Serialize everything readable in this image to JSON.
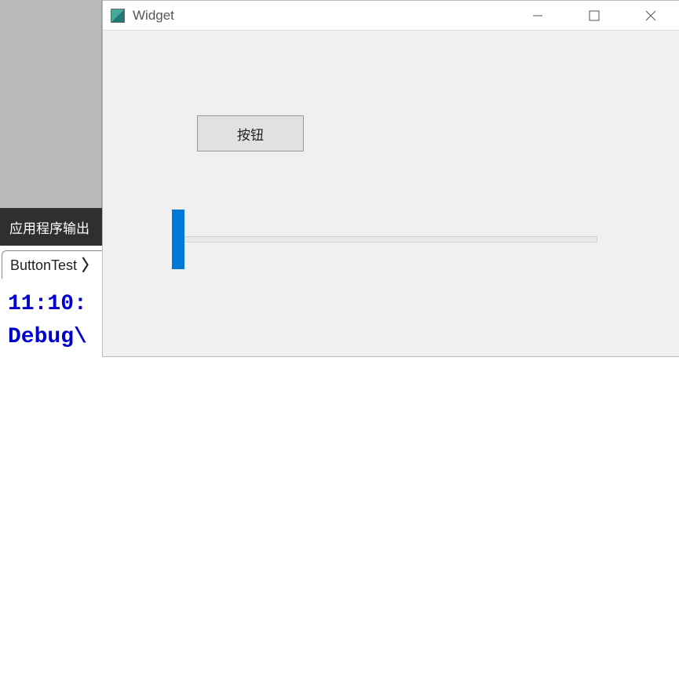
{
  "ide": {
    "output_panel_label": "应用程序输出",
    "tab_label": "ButtonTest",
    "console_line1": "11:10:",
    "console_line2": "Debug\\"
  },
  "widget": {
    "title": "Widget",
    "button_label": "按钮",
    "slider_value": 0
  },
  "icons": {
    "close_tab": "✕"
  }
}
